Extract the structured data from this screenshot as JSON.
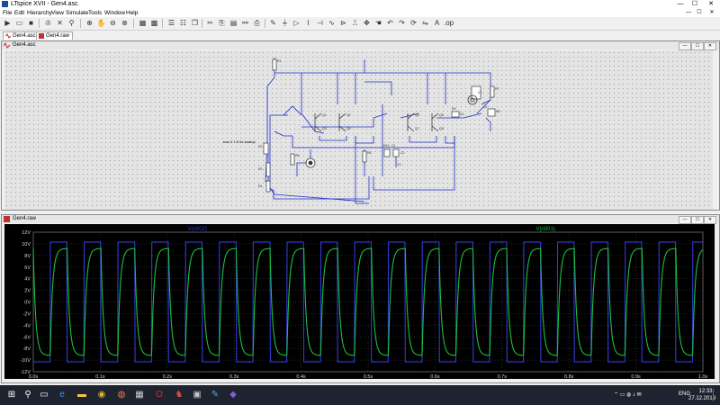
{
  "app": {
    "title": "LTspice XVII - Gen4.asc"
  },
  "window_controls": {
    "minimize": "—",
    "maximize": "☐",
    "close": "✕"
  },
  "menu": [
    "File",
    "Edit",
    "Hierarchy",
    "View",
    "Simulate",
    "Tools",
    "Window",
    "Help"
  ],
  "doc_tabs": [
    {
      "label": "Gen4.asc",
      "icon": "schematic-icon"
    },
    {
      "label": "Gen4.raw",
      "icon": "waveform-icon"
    }
  ],
  "schematic_window": {
    "title": "Gen4.asc",
    "directive": ".tran 0 1.5 0s startup",
    "component_labels": [
      "R1",
      "R2",
      "R3",
      "R4",
      "R5",
      "R6",
      "R7",
      "R8",
      "R9",
      "R10",
      "Q1",
      "Q2",
      "Q3",
      "Q4",
      "Q5",
      "Q6",
      "Q7",
      "Q8",
      "V1",
      "C1",
      "C2",
      "C3",
      "D1",
      "D2"
    ]
  },
  "waveform_window": {
    "title": "Gen4.raw"
  },
  "chart_data": {
    "type": "line",
    "title": "",
    "xlabel": "",
    "ylabel": "",
    "x_ticks": [
      "0.0s",
      "0.1s",
      "0.2s",
      "0.3s",
      "0.4s",
      "0.5s",
      "0.6s",
      "0.7s",
      "0.8s",
      "0.9s",
      "1.0s"
    ],
    "y_ticks": [
      "12V",
      "10V",
      "8V",
      "6V",
      "4V",
      "2V",
      "0V",
      "-2V",
      "-4V",
      "-6V",
      "-8V",
      "-10V",
      "-12V"
    ],
    "xlim": [
      0,
      1.0
    ],
    "ylim": [
      -12,
      12
    ],
    "grid": true,
    "series": [
      {
        "name": "V(n002)",
        "color": "#2f3bd8",
        "waveform": "square",
        "high": 10.3,
        "low": -10.3,
        "period_s": 0.0505,
        "phase_s": 0.0
      },
      {
        "name": "V(n001)",
        "color": "#19c23a",
        "waveform": "rc-square",
        "high": 9.2,
        "low": -9.2,
        "period_s": 0.0505,
        "phase_s": 0.0
      }
    ]
  },
  "taskbar": {
    "items": [
      "windows-start-icon",
      "search-icon",
      "task-view-icon",
      "edge-icon",
      "file-explorer-icon",
      "chrome-icon",
      "firefox-icon",
      "calculator-icon",
      "opera-icon",
      "ltspice-icon",
      "ltspice-wave-icon",
      "paint-icon",
      "visual-studio-icon"
    ],
    "language": "ENG",
    "time": "12:33",
    "date": "27.12.2019"
  }
}
